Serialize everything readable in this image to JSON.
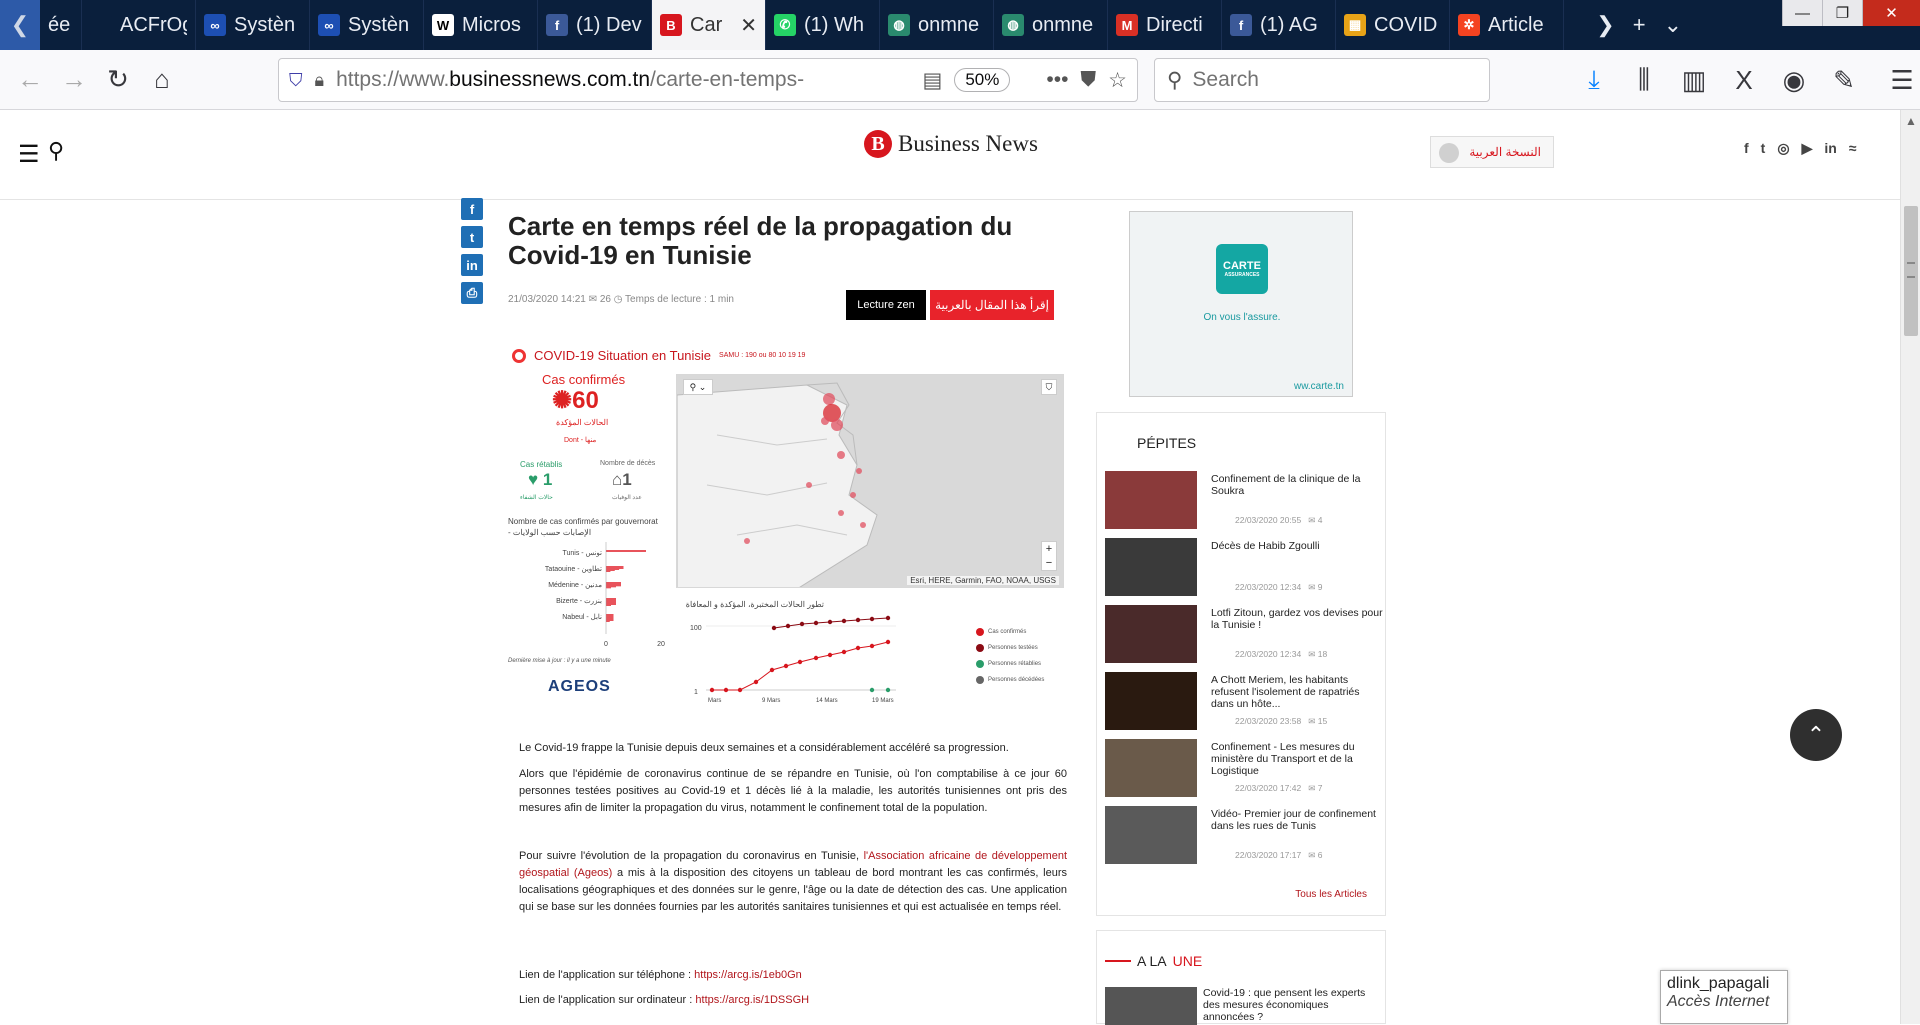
{
  "browser": {
    "tabs": [
      {
        "icon": "page-icon",
        "label": "ée",
        "color": "#2d5aa8"
      },
      {
        "icon": "page-icon",
        "label": "ACFrOgCr",
        "color": "#0a1f3c"
      },
      {
        "icon": "infinity-icon",
        "label": "Systèn",
        "color": "#1d4fb3"
      },
      {
        "icon": "infinity-icon",
        "label": "Systèn",
        "color": "#1d4fb3"
      },
      {
        "icon": "wikipedia-icon",
        "label": "Micros",
        "color": "#ffffff"
      },
      {
        "icon": "facebook-icon",
        "label": "(1) Dev",
        "color": "#3b5998"
      },
      {
        "icon": "businessnews-icon",
        "label": "Car",
        "color": "#d7161e"
      },
      {
        "icon": "whatsapp-icon",
        "label": "(1) Wh",
        "color": "#25d366"
      },
      {
        "icon": "globe-icon",
        "label": "onmne",
        "color": "#2a8a6e"
      },
      {
        "icon": "globe-icon",
        "label": "onmne",
        "color": "#2a8a6e"
      },
      {
        "icon": "gmail-icon",
        "label": "Directi",
        "color": "#d93025"
      },
      {
        "icon": "facebook-icon",
        "label": "(1) AG",
        "color": "#3b5998"
      },
      {
        "icon": "covid-icon",
        "label": "COVID",
        "color": "#e8a317"
      },
      {
        "icon": "joomla-icon",
        "label": "Article",
        "color": "#f44321"
      }
    ],
    "active_tab": 6,
    "url_prefix": "https://www.",
    "url_domain": "businessnews.com.tn",
    "url_path": "/carte-en-temps-",
    "zoom": "50%",
    "search_placeholder": "Search"
  },
  "site": {
    "logo_letter": "B",
    "name": "Business News",
    "arabic_label": "النسخة العربية",
    "socials": [
      "f",
      "t",
      "◎",
      "▶",
      "in",
      "≈"
    ]
  },
  "article": {
    "title": "Carte en temps réel de la propagation du Covid-19 en Tunisie",
    "date": "21/03/2020 14:21",
    "views": "26",
    "reading_time": "Temps de lecture : 1 min",
    "zen_label": "Lecture zen",
    "arabic_read_label": "إقرأ هذا المقال بالعربية",
    "paragraphs": [
      "Le Covid-19 frappe la Tunisie depuis deux semaines et a considérablement accéléré sa progression.",
      "Alors que l'épidémie de coronavirus continue de se répandre en Tunisie, où l'on comptabilise à ce jour 60 personnes testées positives au Covid-19 et 1 décès lié à la maladie, les autorités tunisiennes ont pris des mesures afin de limiter la propagation du virus, notamment le confinement total de la population.",
      "Pour suivre l'évolution de la propagation du coronavirus en Tunisie, ",
      "Lien de l'application sur téléphone : ",
      "Lien de l'application sur ordinateur : "
    ],
    "ageos_link": "l'Association africaine de développement géospatial (Ageos)",
    "p3_rest": " a mis à la disposition des citoyens un tableau de bord montrant les cas confirmés, leurs localisations géographiques et des données sur le genre, l'âge ou la date de détection des cas. Une application qui se base sur les données fournies par les autorités sanitaires tunisiennes et qui est actualisée en temps réel.",
    "phone_link": "https://arcg.is/1eb0Gn",
    "desktop_link": "https://arcg.is/1DSSGH"
  },
  "dashboard": {
    "header": "COVID-19 Situation en Tunisie",
    "samu": "SAMU : 190 ou 80 10 19 19",
    "confirmed_label": "Cas confirmés",
    "confirmed": "60",
    "confirmed_ar": "الحالات المؤكدة",
    "dont": "Dont - منها",
    "recovered_label": "Cas rétablis",
    "recovered": "1",
    "recovered_ar": "حالات الشفاء",
    "deaths_label": "Nombre de décès",
    "deaths": "1",
    "deaths_ar": "عدد الوفيات",
    "gov_label": "Nombre de cas confirmés par gouvernorat - الإصابات حسب الولايات",
    "updated": "Dernière mise à jour : il y a une minute",
    "ageos": "AGEOS",
    "map_credit": "Esri, HERE, Garmin, FAO, NOAA, USGS",
    "line_title": "تطور الحالات المختبرة، المؤكدة و المعافاة",
    "legend": [
      {
        "label": "Cas confirmés",
        "color": "#d7161e"
      },
      {
        "label": "Personnes testées",
        "color": "#8b0b14"
      },
      {
        "label": "Personnes rétablies",
        "color": "#2a9d6a"
      },
      {
        "label": "Personnes décédées",
        "color": "#666666"
      }
    ]
  },
  "chart_data": {
    "type": "bar",
    "title": "Nombre de cas confirmés par gouvernorat - الإصابات حسب الولايات",
    "categories": [
      "Tunis - تونس",
      "Tataouine - تطاوين",
      "Médenine - مدنين",
      "Bizerte - بنزرت",
      "Nabeul - نابل"
    ],
    "values": [
      16,
      7,
      6,
      4,
      3
    ],
    "xticks": [
      "0",
      "20"
    ],
    "xlim": [
      0,
      20
    ]
  },
  "sidebar": {
    "ad_brand": "CARTE",
    "ad_sub": "ASSURANCES",
    "ad_tagline": "On vous l'assure.",
    "ad_url": "ww.carte.tn",
    "pepites_title": "PÉPITES",
    "pepites": [
      {
        "title": "Confinement de la clinique de la Soukra",
        "date": "22/03/2020 20:55",
        "views": "4"
      },
      {
        "title": "Décès de Habib Zgoulli",
        "date": "22/03/2020 12:34",
        "views": "9"
      },
      {
        "title": "Lotfi Zitoun, gardez vos devises pour la Tunisie !",
        "date": "22/03/2020 12:34",
        "views": "18"
      },
      {
        "title": "A Chott Meriem, les habitants refusent l'isolement de rapatriés dans un hôte...",
        "date": "22/03/2020 23:58",
        "views": "15"
      },
      {
        "title": "Confinement - Les mesures du ministère du Transport et de la Logistique",
        "date": "22/03/2020 17:42",
        "views": "7"
      },
      {
        "title": "Vidéo- Premier jour de confinement dans les rues de Tunis",
        "date": "22/03/2020 17:17",
        "views": "6"
      }
    ],
    "all_articles": "Tous les Articles",
    "alaune_pre": "A LA",
    "alaune_em": "UNE",
    "alaune_item": "Covid-19 : que pensent les experts des mesures économiques annoncées ?"
  },
  "network": {
    "ssid": "dlink_papagali",
    "status": "Accès Internet"
  }
}
